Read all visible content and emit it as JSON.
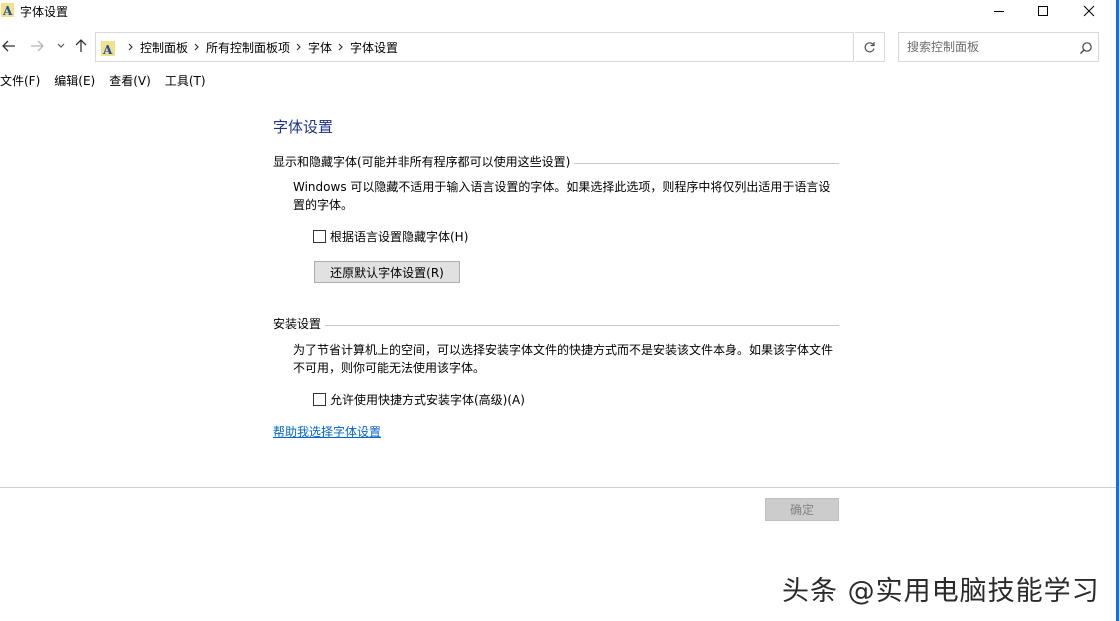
{
  "window": {
    "title": "字体设置"
  },
  "address_bar": {
    "crumbs": [
      "控制面板",
      "所有控制面板项",
      "字体",
      "字体设置"
    ]
  },
  "search": {
    "placeholder": "搜索控制面板"
  },
  "menu": {
    "items": [
      "文件(F)",
      "编辑(E)",
      "查看(V)",
      "工具(T)"
    ]
  },
  "main": {
    "page_title": "字体设置",
    "section_show_hide": {
      "header": "显示和隐藏字体(可能并非所有程序都可以使用这些设置)",
      "description": "Windows 可以隐藏不适用于输入语言设置的字体。如果选择此选项，则程序中将仅列出适用于语言设置的字体。",
      "checkbox_label": "根据语言设置隐藏字体(H)",
      "checkbox_checked": false,
      "restore_button": "还原默认字体设置(R)"
    },
    "section_install": {
      "header": "安装设置",
      "description": "为了节省计算机上的空间，可以选择安装字体文件的快捷方式而不是安装该文件本身。如果该字体文件不可用，则你可能无法使用该字体。",
      "checkbox_label": "允许使用快捷方式安装字体(高级)(A)",
      "checkbox_checked": false
    },
    "help_link": "帮助我选择字体设置"
  },
  "footer": {
    "ok_button": "确定"
  },
  "watermark": "头条 @实用电脑技能学习",
  "colors": {
    "title_blue": "#1e3287",
    "link_blue": "#0066cc"
  }
}
